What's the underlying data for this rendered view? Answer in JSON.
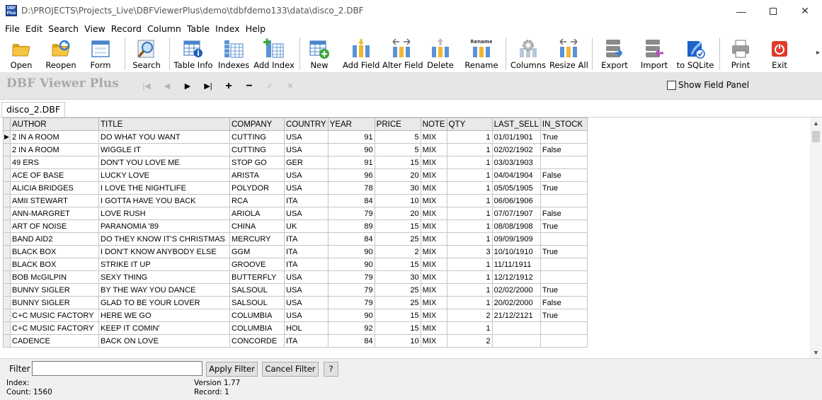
{
  "window": {
    "title": "D:\\PROJECTS\\Projects_Live\\DBFViewerPlus\\demo\\tdbfdemo133\\data\\disco_2.DBF",
    "icon_text": "DBF Plus",
    "minimize": "—",
    "close": "✕"
  },
  "menu": [
    "File",
    "Edit",
    "Search",
    "View",
    "Record",
    "Column",
    "Table",
    "Index",
    "Help"
  ],
  "toolbar": {
    "open": "Open",
    "reopen": "Reopen",
    "form": "Form",
    "search": "Search",
    "table_info": "Table Info",
    "indexes": "Indexes",
    "add_index": "Add Index",
    "new": "New",
    "add_field": "Add Field",
    "alter_field": "Alter Field",
    "delete": "Delete",
    "rename": "Rename",
    "rename_icon_text": "Rename",
    "columns": "Columns",
    "resize_all": "Resize All",
    "export": "Export",
    "import": "Import",
    "to_sqlite": "to SQLite",
    "print": "Print",
    "exit": "Exit",
    "more": "▸"
  },
  "navbar": {
    "brand": "DBF Viewer Plus",
    "first": "|◀",
    "prior": "◀",
    "next": "▶",
    "last": "▶|",
    "insert": "+",
    "delete": "−",
    "post": "✓",
    "cancel": "✕",
    "show_field_panel": "Show Field Panel"
  },
  "tab": {
    "label": "disco_2.DBF"
  },
  "grid": {
    "columns": [
      "AUTHOR",
      "TITLE",
      "COMPANY",
      "COUNTRY",
      "YEAR",
      "PRICE",
      "NOTE",
      "QTY",
      "LAST_SELL",
      "IN_STOCK"
    ],
    "current_row_marker": "▶",
    "rows": [
      [
        "2 IN A ROOM",
        "DO WHAT YOU WANT",
        "CUTTING",
        "USA",
        "91",
        "5",
        "MIX",
        "1",
        "01/01/1901",
        "True"
      ],
      [
        "2 IN A ROOM",
        "WIGGLE IT",
        "CUTTING",
        "USA",
        "90",
        "5",
        "MIX",
        "1",
        "02/02/1902",
        "False"
      ],
      [
        "49 ERS",
        "DON'T YOU LOVE ME",
        "STOP GO",
        "GER",
        "91",
        "15",
        "MIX",
        "1",
        "03/03/1903",
        ""
      ],
      [
        "ACE OF BASE",
        "LUCKY LOVE",
        "ARISTA",
        "USA",
        "96",
        "20",
        "MIX",
        "1",
        "04/04/1904",
        "False"
      ],
      [
        "ALICIA BRIDGES",
        "I LOVE THE NIGHTLIFE",
        "POLYDOR",
        "USA",
        "78",
        "30",
        "MIX",
        "1",
        "05/05/1905",
        "True"
      ],
      [
        "AMII STEWART",
        "I GOTTA HAVE YOU BACK",
        "RCA",
        "ITA",
        "84",
        "10",
        "MIX",
        "1",
        "06/06/1906",
        ""
      ],
      [
        "ANN-MARGRET",
        "LOVE RUSH",
        "ARIOLA",
        "USA",
        "79",
        "20",
        "MIX",
        "1",
        "07/07/1907",
        "False"
      ],
      [
        "ART OF NOISE",
        "PARANOMIA '89",
        "CHINA",
        "UK",
        "89",
        "15",
        "MIX",
        "1",
        "08/08/1908",
        "True"
      ],
      [
        "BAND AID2",
        "DO THEY KNOW IT'S CHRISTMAS",
        "MERCURY",
        "ITA",
        "84",
        "25",
        "MIX",
        "1",
        "09/09/1909",
        ""
      ],
      [
        "BLACK BOX",
        "I DON'T KNOW ANYBODY ELSE",
        "GGM",
        "ITA",
        "90",
        "2",
        "MIX",
        "3",
        "10/10/1910",
        "True"
      ],
      [
        "BLACK BOX",
        "STRIKE IT UP",
        "GROOVE",
        "ITA",
        "90",
        "15",
        "MIX",
        "1",
        "11/11/1911",
        ""
      ],
      [
        "BOB McGILPIN",
        "SEXY THING",
        "BUTTERFLY",
        "USA",
        "79",
        "30",
        "MIX",
        "1",
        "12/12/1912",
        ""
      ],
      [
        "BUNNY SIGLER",
        "BY THE WAY YOU DANCE",
        "SALSOUL",
        "USA",
        "79",
        "25",
        "MIX",
        "1",
        "02/02/2000",
        "True"
      ],
      [
        "BUNNY SIGLER",
        "GLAD TO BE YOUR LOVER",
        "SALSOUL",
        "USA",
        "79",
        "25",
        "MIX",
        "1",
        "20/02/2000",
        "False"
      ],
      [
        "C+C MUSIC FACTORY",
        "HERE WE GO",
        "COLUMBIA",
        "USA",
        "90",
        "15",
        "MIX",
        "2",
        "21/12/2121",
        "True"
      ],
      [
        "C+C MUSIC FACTORY",
        "KEEP IT COMIN'",
        "COLUMBIA",
        "HOL",
        "92",
        "15",
        "MIX",
        "1",
        "",
        ""
      ],
      [
        "CADENCE",
        "BACK ON LOVE",
        "CONCORDE",
        "ITA",
        "84",
        "10",
        "MIX",
        "2",
        "",
        ""
      ]
    ],
    "scroll_up": "▲",
    "scroll_down": "▼"
  },
  "filter": {
    "label": "Filter",
    "value": "",
    "apply": "Apply Filter",
    "cancel": "Cancel Filter",
    "help": "?"
  },
  "status": {
    "index": "Index:",
    "count": "Count: 1560",
    "version": "Version 1.77",
    "record": "Record: 1"
  }
}
